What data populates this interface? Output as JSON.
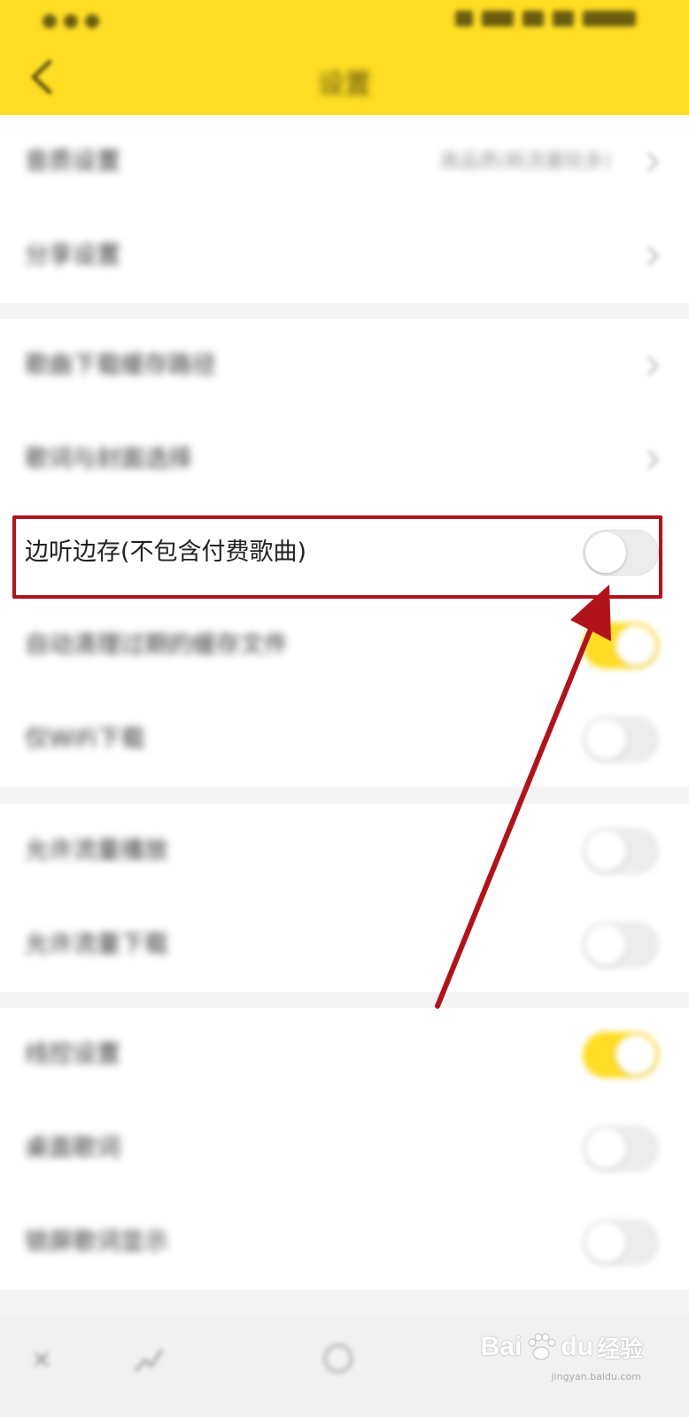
{
  "header": {
    "title": "设置",
    "back_icon": "chevron-left-icon",
    "background": "#fedd24"
  },
  "rows": [
    {
      "label": "音质设置",
      "value": "高品质(耗流量较多)",
      "type": "nav"
    },
    {
      "label": "分享设置",
      "value": "",
      "type": "nav"
    },
    {
      "label": "歌曲下载缓存路径",
      "value": "",
      "type": "nav"
    },
    {
      "label": "歌词与封面选择",
      "value": "",
      "type": "nav"
    },
    {
      "label": "边听边存(不包含付费歌曲)",
      "value": "",
      "type": "toggle",
      "on": false
    },
    {
      "label": "自动清理过期的缓存文件",
      "value": "",
      "type": "toggle",
      "on": true
    },
    {
      "label": "仅WiFi下载",
      "value": "",
      "type": "toggle",
      "on": false
    },
    {
      "label": "允许流量播放",
      "value": "",
      "type": "toggle",
      "on": false
    },
    {
      "label": "允许流量下载",
      "value": "",
      "type": "toggle",
      "on": false
    },
    {
      "label": "线控设置",
      "value": "",
      "type": "toggle",
      "on": true
    },
    {
      "label": "桌面歌词",
      "value": "",
      "type": "toggle",
      "on": false
    },
    {
      "label": "锁屏歌词显示",
      "value": "",
      "type": "toggle",
      "on": false
    }
  ],
  "watermark": {
    "brand": "Bai",
    "brand2": "du",
    "suffix": "经验",
    "url": "jingyan.baidu.com"
  },
  "colors": {
    "accent": "#fedd24",
    "annotation": "#b0141a"
  }
}
